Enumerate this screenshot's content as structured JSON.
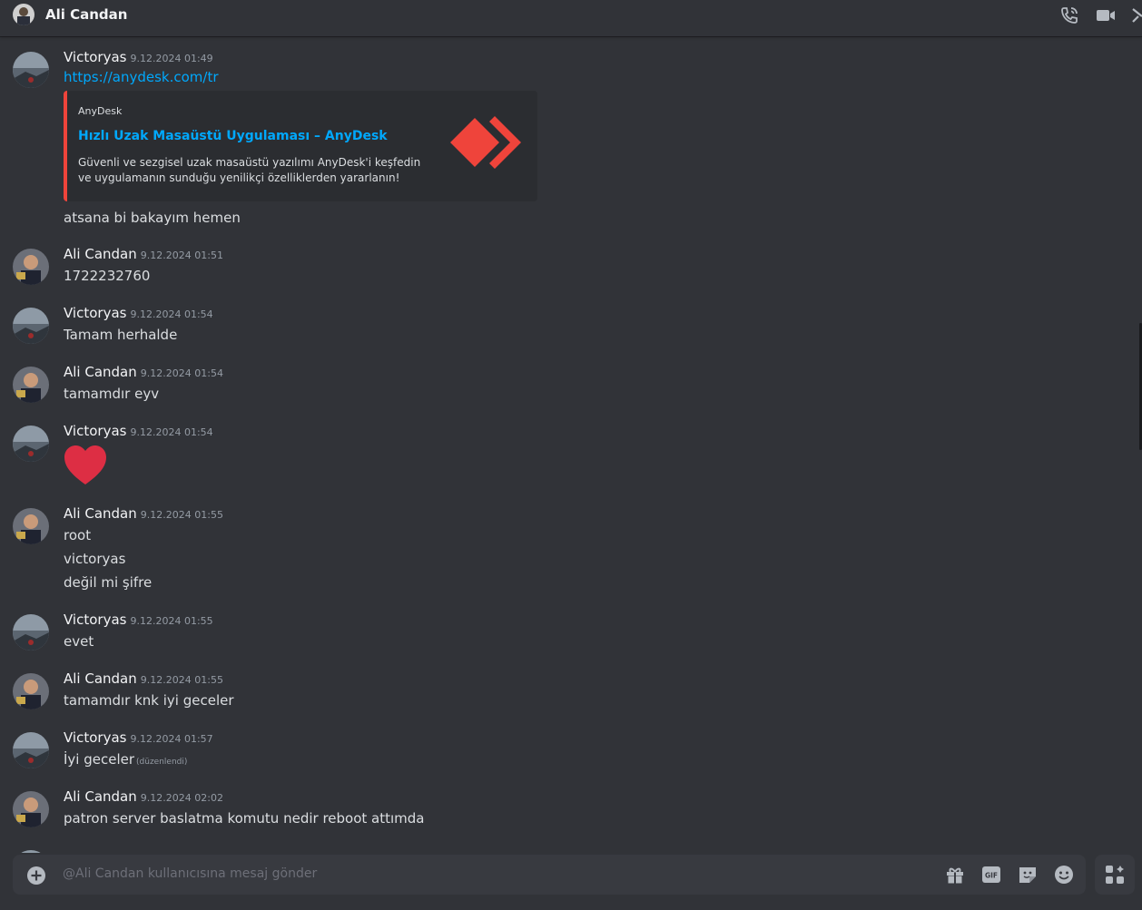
{
  "header": {
    "title": "Ali Candan"
  },
  "embed": {
    "provider": "AnyDesk",
    "title": "Hızlı Uzak Masaüstü Uygulaması – AnyDesk",
    "description": "Güvenli ve sezgisel uzak masaüstü yazılımı AnyDesk'i keşfedin ve uygulamanın sunduğu yenilikçi özelliklerden yararlanın!"
  },
  "messages": [
    {
      "author": "Victoryas",
      "time": "9.12.2024 01:49",
      "lines": [
        "https://anydesk.com/tr",
        "atsana bi bakayım hemen"
      ]
    },
    {
      "author": "Ali Candan",
      "time": "9.12.2024 01:51",
      "lines": [
        "1722232760"
      ]
    },
    {
      "author": "Victoryas",
      "time": "9.12.2024 01:54",
      "lines": [
        "Tamam herhalde"
      ]
    },
    {
      "author": "Ali Candan",
      "time": "9.12.2024 01:54",
      "lines": [
        "tamamdır eyv"
      ]
    },
    {
      "author": "Victoryas",
      "time": "9.12.2024 01:54",
      "lines": [],
      "emoji": "heart"
    },
    {
      "author": "Ali Candan",
      "time": "9.12.2024 01:55",
      "lines": [
        "root",
        "victoryas",
        "değil mi şifre"
      ]
    },
    {
      "author": "Victoryas",
      "time": "9.12.2024 01:55",
      "lines": [
        "evet"
      ]
    },
    {
      "author": "Ali Candan",
      "time": "9.12.2024 01:55",
      "lines": [
        "tamamdır knk iyi geceler"
      ]
    },
    {
      "author": "Victoryas",
      "time": "9.12.2024 01:57",
      "lines": [
        "İyi geceler"
      ],
      "edited": "(düzenlendi)"
    },
    {
      "author": "Ali Candan",
      "time": "9.12.2024 02:02",
      "lines": [
        "patron server baslatma komutu nedir reboot attımda"
      ]
    }
  ],
  "composer": {
    "placeholder": "@Ali Candan kullanıcısına mesaj gönder"
  },
  "icons": {
    "header": [
      "phone-call-icon",
      "video-call-icon",
      "pin-icon"
    ],
    "composer": [
      "add-attachment-icon",
      "gift-icon",
      "gif-icon",
      "sticker-icon",
      "emoji-icon"
    ],
    "apps": "apps-icon"
  },
  "colors": {
    "background": "#313338",
    "link": "#00a8fc",
    "embed_accent": "#ef443b",
    "heart": "#dd2e44"
  }
}
